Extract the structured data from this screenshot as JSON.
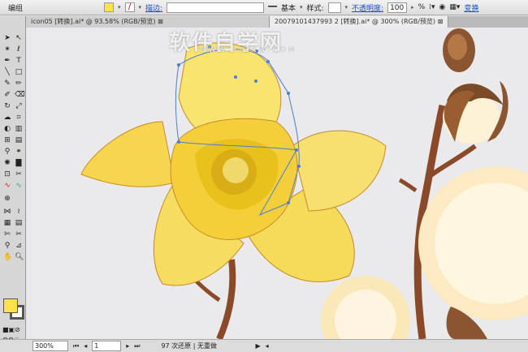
{
  "control_bar": {
    "mode": "编组",
    "stroke_label": "描边:",
    "profile": "基本",
    "style_label": "样式:",
    "opacity_label": "不透明度:",
    "opacity_value": "100",
    "opacity_unit": "%",
    "transform": "变换",
    "fill_color": "#ffe24a"
  },
  "tabs": [
    {
      "label": "icon05 [转换].ai* @ 93.58% (RGB/预览)"
    },
    {
      "label": "20079101437993 2 [转换].ai* @ 300% (RGB/预览)"
    }
  ],
  "watermark": {
    "title": "软件自学网",
    "url": "WWW.RJZXW.COM"
  },
  "status": {
    "zoom": "300%",
    "page": "1",
    "message": "97 次还原 | 无重做"
  }
}
